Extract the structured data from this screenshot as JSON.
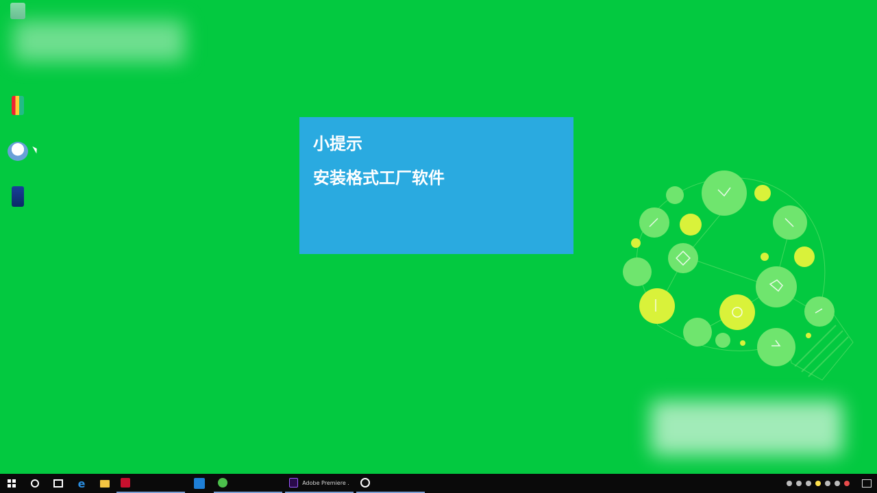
{
  "tip": {
    "title": "小提示",
    "body": "安装格式工厂软件"
  },
  "colors": {
    "desktop_bg": "#03c940",
    "tip_bg": "#2aaae0",
    "taskbar_bg": "#0a0a0a",
    "bulb_light": "#7ee86a",
    "bulb_yellow": "#d9f23a"
  },
  "icons": {
    "start": "windows-start-icon",
    "search": "cortana-search-icon",
    "task_view": "task-view-icon",
    "edge": "edge-browser-icon",
    "explorer": "file-explorer-icon",
    "notifications": "action-center-icon"
  },
  "taskbar": {
    "edge_glyph": "e",
    "apps": [
      {
        "label": ""
      },
      {
        "label": ""
      },
      {
        "label": ""
      },
      {
        "label": "Adobe Premiere ..."
      },
      {
        "label": ""
      }
    ]
  }
}
